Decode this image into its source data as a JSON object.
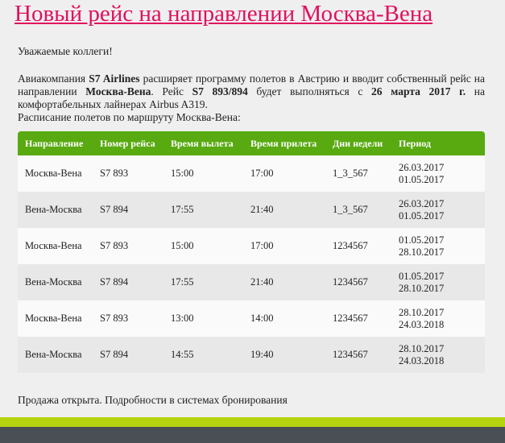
{
  "headline": "Новый рейс на направлении Москва-Вена",
  "greeting": "Уважаемые коллеги!",
  "intro": {
    "p1": "Авиакомпания ",
    "airline": "S7 Airlines",
    "p2": " расширяет программу полетов в Австрию и вводит собственный рейс на направлении ",
    "route": "Москва-Вена",
    "p3": ". Рейс ",
    "flights": "S7 893/894",
    "p4": " будет выполняться с ",
    "start_date": "26 марта 2017 г.",
    "p5": " на комфортабельных лайнерах Airbus A319."
  },
  "schedule_title": "Расписание полетов по маршруту Москва-Вена:",
  "table": {
    "headers": [
      "Направление",
      "Номер рейса",
      "Время вылета",
      "Время прилета",
      "Дни недели",
      "Период"
    ],
    "rows": [
      {
        "direction": "Москва-Вена",
        "flight": "S7 893",
        "dep": "15:00",
        "arr": "17:00",
        "days": "1_3_567",
        "period_from": "26.03.2017",
        "period_to": "01.05.2017"
      },
      {
        "direction": "Вена-Москва",
        "flight": "S7 894",
        "dep": "17:55",
        "arr": "21:40",
        "days": "1_3_567",
        "period_from": "26.03.2017",
        "period_to": "01.05.2017"
      },
      {
        "direction": "Москва-Вена",
        "flight": "S7 893",
        "dep": "15:00",
        "arr": "17:00",
        "days": "1234567",
        "period_from": "01.05.2017",
        "period_to": "28.10.2017"
      },
      {
        "direction": "Вена-Москва",
        "flight": "S7 894",
        "dep": "17:55",
        "arr": "21:40",
        "days": "1234567",
        "period_from": "01.05.2017",
        "period_to": "28.10.2017"
      },
      {
        "direction": "Москва-Вена",
        "flight": "S7 893",
        "dep": "13:00",
        "arr": "14:00",
        "days": "1234567",
        "period_from": "28.10.2017",
        "period_to": "24.03.2018"
      },
      {
        "direction": "Вена-Москва",
        "flight": "S7 894",
        "dep": "14:55",
        "arr": "19:40",
        "days": "1234567",
        "period_from": "28.10.2017",
        "period_to": "24.03.2018"
      }
    ]
  },
  "footer_note": "Продажа открыта. Подробности в системах бронирования",
  "colors": {
    "headline": "#e0115f",
    "table_header": "#58aa10",
    "bottom_bar_green": "#b5d30f",
    "bottom_bar_dark": "#4a4e55"
  }
}
